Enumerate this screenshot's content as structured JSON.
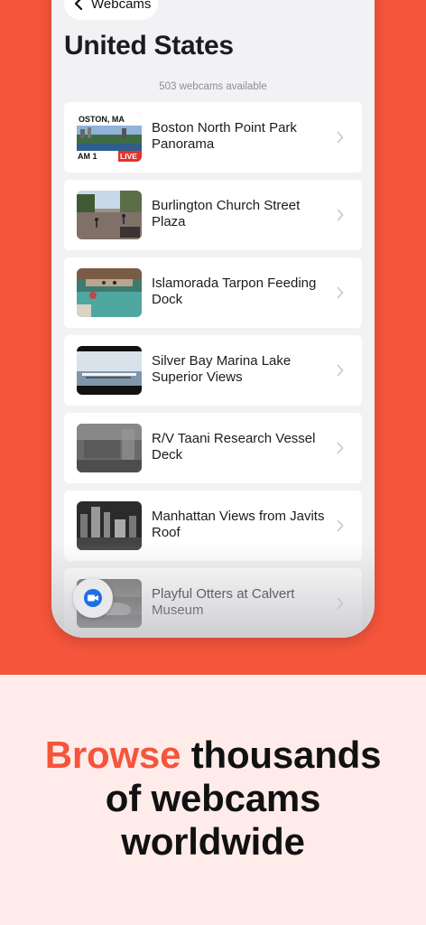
{
  "nav": {
    "back_label": "Webcams"
  },
  "page": {
    "title": "United States",
    "count": "503 webcams available"
  },
  "webcams": [
    {
      "title": "Boston North Point Park Panorama",
      "thumb_text_top": "OSTON, MA",
      "thumb_text_bottom": "AM 1",
      "thumb_badge": "LIVE"
    },
    {
      "title": "Burlington Church Street Plaza"
    },
    {
      "title": "Islamorada Tarpon Feeding Dock"
    },
    {
      "title": "Silver Bay Marina Lake Superior Views"
    },
    {
      "title": "R/V Taani Research Vessel Deck"
    },
    {
      "title": "Manhattan Views from Javits Roof"
    },
    {
      "title": "Playful Otters at Calvert Museum"
    }
  ],
  "promo": {
    "accent_word": "Browse",
    "rest_line1": " thousands",
    "line2": "of webcams",
    "line3": "worldwide"
  },
  "colors": {
    "accent": "#f5553b",
    "promo_bg": "#ffecea",
    "live_badge": "#e5322d"
  },
  "icons": {
    "back": "chevron-left-icon",
    "row_chevron": "chevron-right-icon",
    "fab": "video-camera-icon"
  }
}
